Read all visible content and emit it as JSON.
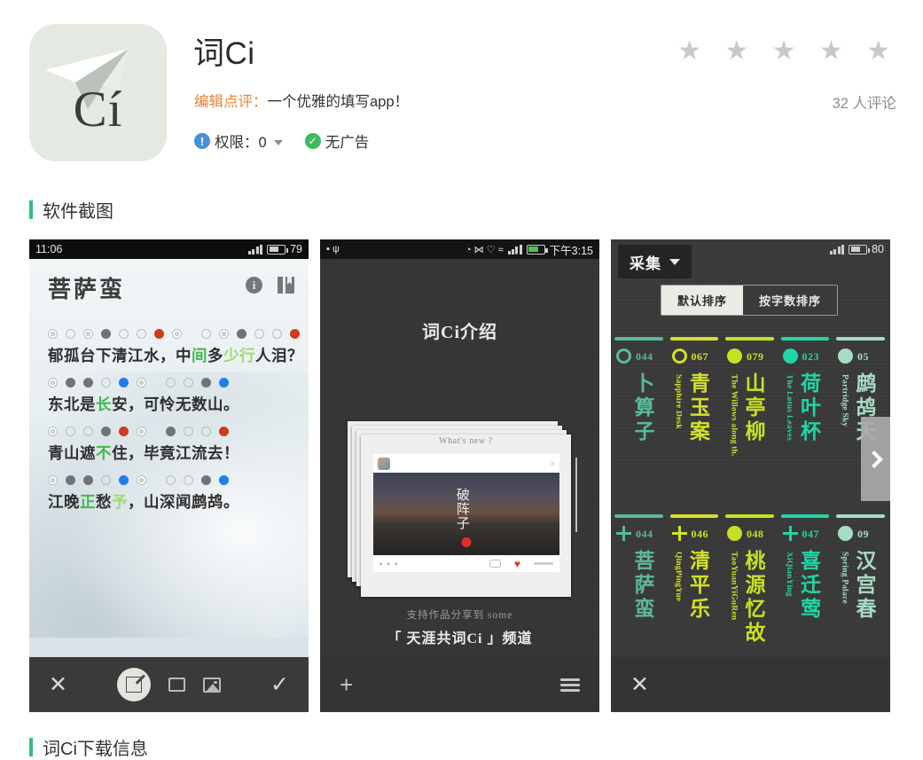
{
  "header": {
    "icon_text": "Cí",
    "icon_name": "paper-plane-ci-icon",
    "title": "词Ci",
    "editor_label": "编辑点评：",
    "editor_comment": "一个优雅的填写app！",
    "permission_label": "权限：0",
    "no_ads_label": "无广告",
    "stars": "★ ★ ★ ★ ★",
    "star_count": 5,
    "review_count": "32 人评论"
  },
  "sections": {
    "screenshots_title": "软件截图",
    "download_title": "词Ci下载信息",
    "accent_color": "#2ec17d"
  },
  "shot1": {
    "status_time": "11:06",
    "status_battery": "79",
    "poem_title": "菩萨蛮",
    "lines": [
      {
        "dots": [
          "ring",
          "open",
          "ring",
          "gray",
          "open",
          "open",
          "red",
          "sp-ring",
          "open",
          "ring",
          "gray",
          "open",
          "open",
          "red"
        ],
        "text_pre": "郁孤台下清江水，中",
        "text_g1": "间",
        "text_mid": "多",
        "text_g2": "少行",
        "text_post": "人泪？"
      },
      {
        "dots": [
          "ring",
          "gray",
          "gray",
          "open",
          "blue",
          "sp-ring",
          "open",
          "open",
          "gray",
          "blue"
        ],
        "text_pre": "东北是",
        "text_g1": "长",
        "text_mid": "",
        "text_g2": "",
        "text_post": "安，可怜无数山。"
      },
      {
        "dots": [
          "ring",
          "open",
          "open",
          "gray",
          "red",
          "sp-ring",
          "gray",
          "open",
          "open",
          "red"
        ],
        "text_pre": "青山遮",
        "text_g1": "不",
        "text_mid": "",
        "text_g2": "",
        "text_post": "住，毕竟江流去！"
      },
      {
        "dots": [
          "ring",
          "gray",
          "gray",
          "open",
          "blue",
          "sp-ring",
          "open",
          "open",
          "gray",
          "blue"
        ],
        "text_pre": "江晚",
        "text_g1": "正",
        "text_mid": "愁",
        "text_g2": "予",
        "text_post": "，山深闻鹧鸪。"
      }
    ],
    "toolbar": {
      "close": "✕",
      "edit": "edit-icon",
      "square": "square-icon",
      "image": "image-icon",
      "confirm": "✓"
    }
  },
  "shot2": {
    "status_time": "下午3:15",
    "title": "词Ci介绍",
    "card": {
      "whats_new": "What's new ?",
      "poem_word": "破阵子",
      "dots": "• • •"
    },
    "caption_small": "支持作品分享到 some",
    "caption_big": "「 天涯共词Ci 」频道",
    "toolbar": {
      "add": "+",
      "menu": "menu-icon"
    }
  },
  "shot3": {
    "status_battery": "80",
    "collect_label": "采集",
    "sort_default": "默认排序",
    "sort_by_count": "按字数排序",
    "rows": [
      [
        {
          "num": "044",
          "cn": "卜算子",
          "en": "",
          "color": "#5cb99a",
          "marker": "ring",
          "partial": true
        },
        {
          "num": "067",
          "cn": "青玉案",
          "en": "Sapphire Desk",
          "color": "#d4e02a",
          "marker": "ring"
        },
        {
          "num": "079",
          "cn": "山亭柳",
          "en": "The Willows along th.",
          "color": "#c8e022",
          "marker": "dot"
        },
        {
          "num": "023",
          "cn": "荷叶杯",
          "en": "The Lotus Leaves",
          "color": "#1fd6a6",
          "marker": "dot"
        },
        {
          "num": "05",
          "cn": "鹧鸪天",
          "en": "Partridge Sky",
          "color": "#a9dcc5",
          "marker": "dot",
          "clipped": true
        }
      ],
      [
        {
          "num": "044",
          "cn": "菩萨蛮",
          "en": "",
          "color": "#5cb99a",
          "marker": "plus",
          "partial": true
        },
        {
          "num": "046",
          "cn": "清平乐",
          "en": "QingPingYue",
          "color": "#d4e02a",
          "marker": "plus"
        },
        {
          "num": "048",
          "cn": "桃源忆故",
          "en": "TaoYuanYiGuRen",
          "color": "#c8e022",
          "marker": "dot"
        },
        {
          "num": "047",
          "cn": "喜迁莺",
          "en": "XiQianYing",
          "color": "#1fd6a6",
          "marker": "plus"
        },
        {
          "num": "09",
          "cn": "汉宫春",
          "en": "Spring Palace",
          "color": "#a9dcc5",
          "marker": "dot",
          "clipped": true
        }
      ]
    ],
    "toolbar": {
      "close": "✕"
    },
    "next_arrow": "›"
  }
}
